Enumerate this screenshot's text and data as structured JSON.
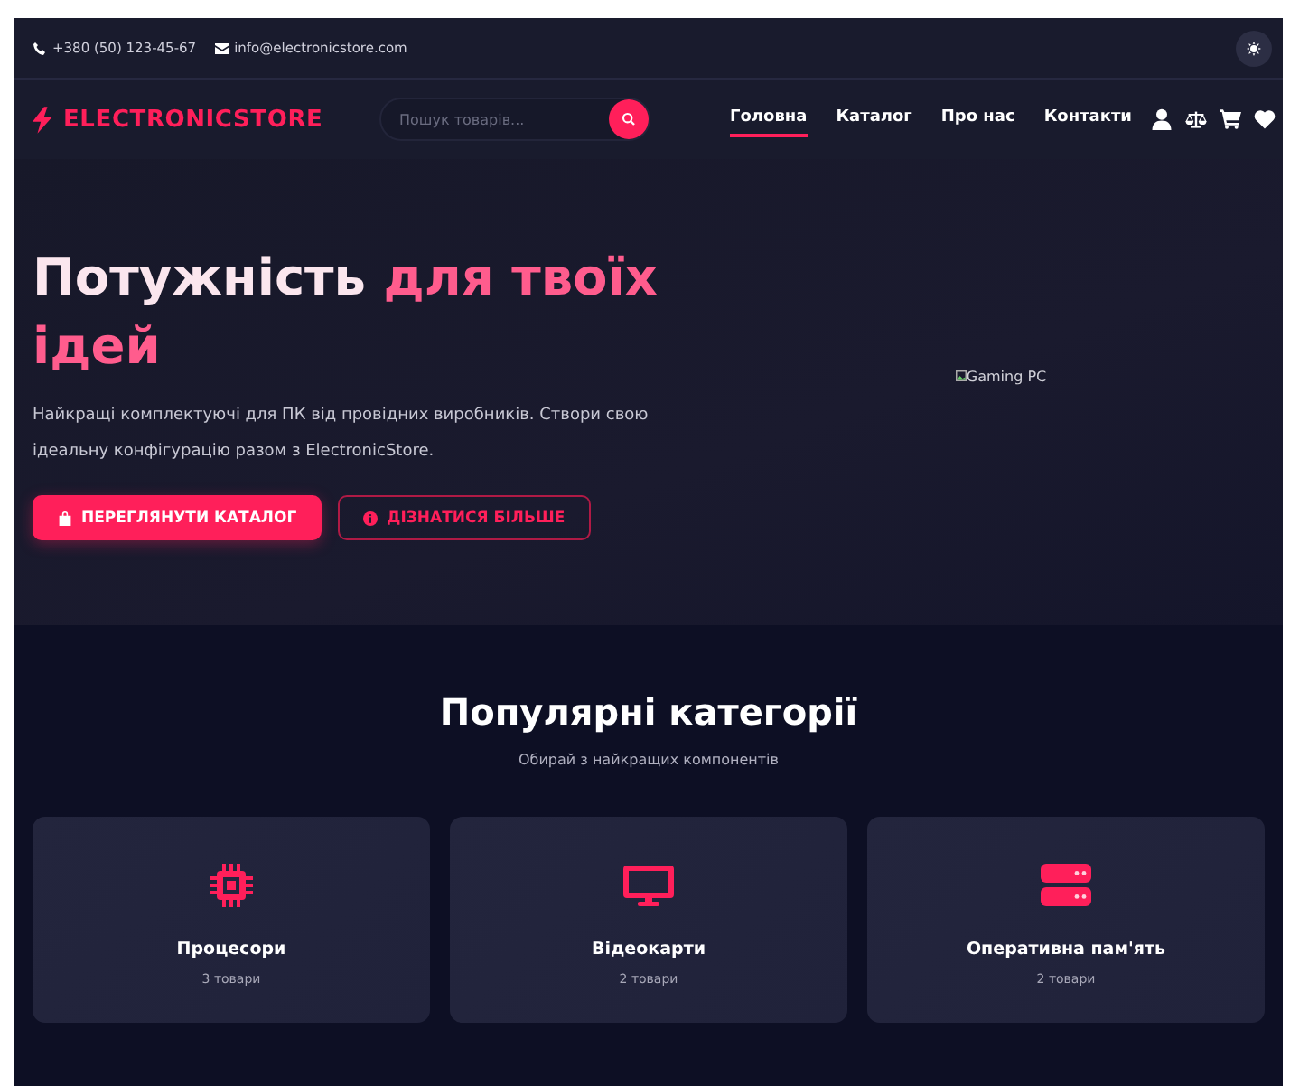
{
  "top_bar": {
    "phone": "+380 (50) 123-45-67",
    "email": "info@electronicstore.com"
  },
  "header": {
    "logo": "ELECTRONICSTORE",
    "search": {
      "placeholder": "Пошук товарів..."
    },
    "nav": [
      {
        "label": "Головна",
        "selected": true
      },
      {
        "label": "Каталог",
        "selected": false
      },
      {
        "label": "Про нас",
        "selected": false
      },
      {
        "label": "Контакти",
        "selected": false
      }
    ]
  },
  "hero": {
    "title_plain": "Потужність",
    "title_accent": "для твоїх ідей",
    "text": "Найкращі комплектуючі для ПК від провідних виробників. Створи свою ідеальну конфігурацію разом з ElectronicStore.",
    "buttons": [
      {
        "kind": "primary",
        "label": "ПЕРЕГЛЯНУТИ КАТАЛОГ"
      },
      {
        "kind": "outline",
        "label": "ДІЗНАТИСЯ БІЛЬШЕ"
      }
    ],
    "image_alt": "Gaming PC"
  },
  "categories": {
    "title": "Популярні категорії",
    "subtitle": "Обирай з найкращих компонентів",
    "items": [
      {
        "name": "Процесори",
        "count": "3 товари"
      },
      {
        "name": "Відеокарти",
        "count": "2 товари"
      },
      {
        "name": "Оперативна пам'ять",
        "count": "2 товари"
      }
    ]
  }
}
